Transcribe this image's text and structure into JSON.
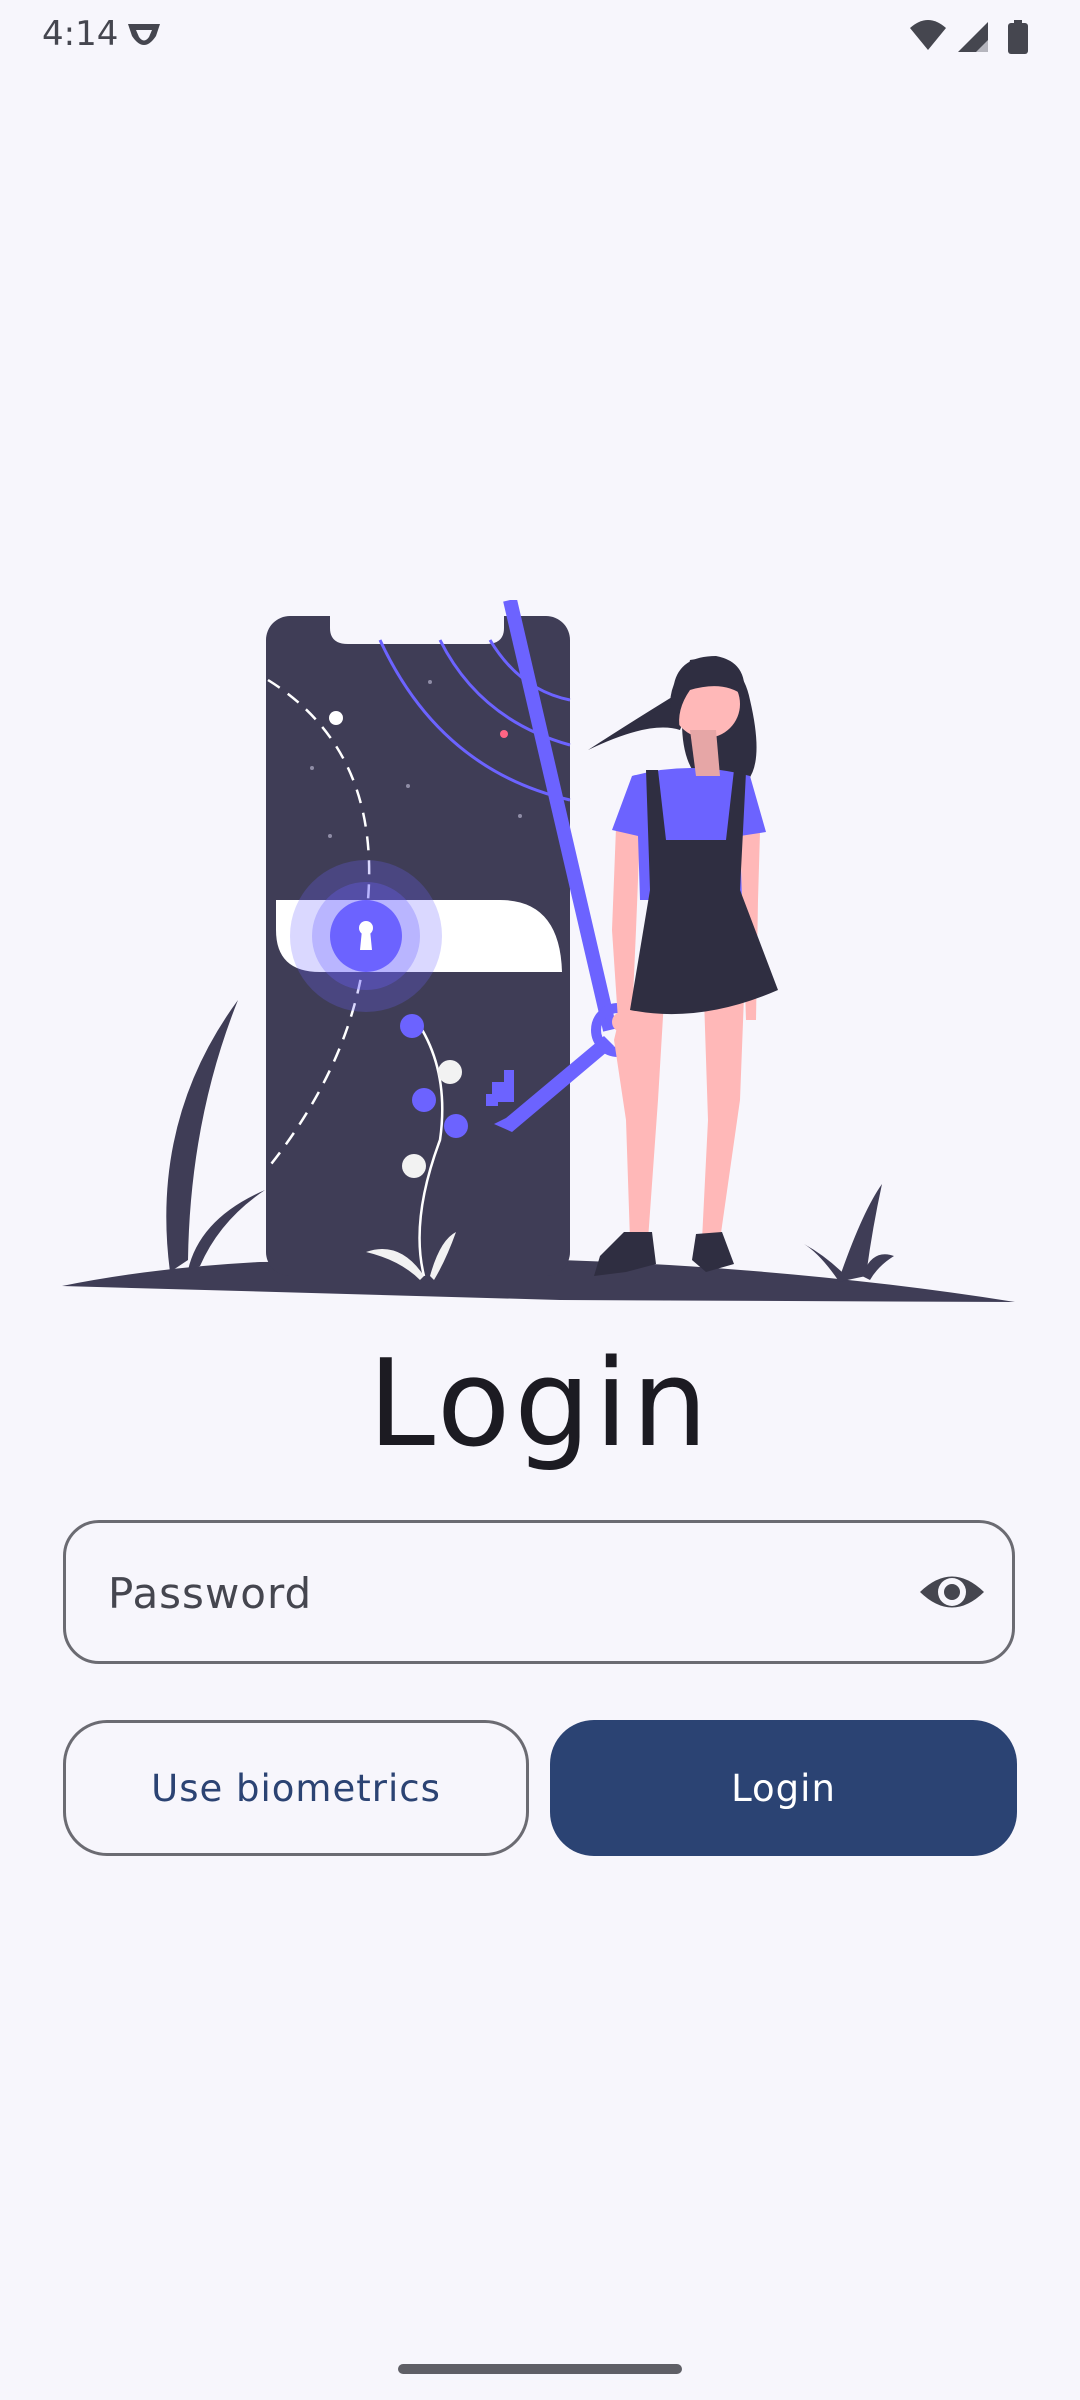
{
  "status_bar": {
    "time": "4:14",
    "icons": [
      "app-notification-icon",
      "wifi-icon",
      "cell-signal-icon",
      "battery-icon"
    ]
  },
  "screen": {
    "title": "Login",
    "illustration": "phone-lock-woman-with-key-illustration"
  },
  "password_field": {
    "placeholder": "Password",
    "value": "",
    "toggle_icon": "eye-icon"
  },
  "buttons": {
    "biometrics_label": "Use biometrics",
    "login_label": "Login"
  },
  "colors": {
    "background": "#f7f6fc",
    "primary": "#2b4373",
    "accent": "#6c63ff",
    "outline": "#6b6b72",
    "illustration_dark": "#3f3d56",
    "skin": "#ffb8b8"
  }
}
